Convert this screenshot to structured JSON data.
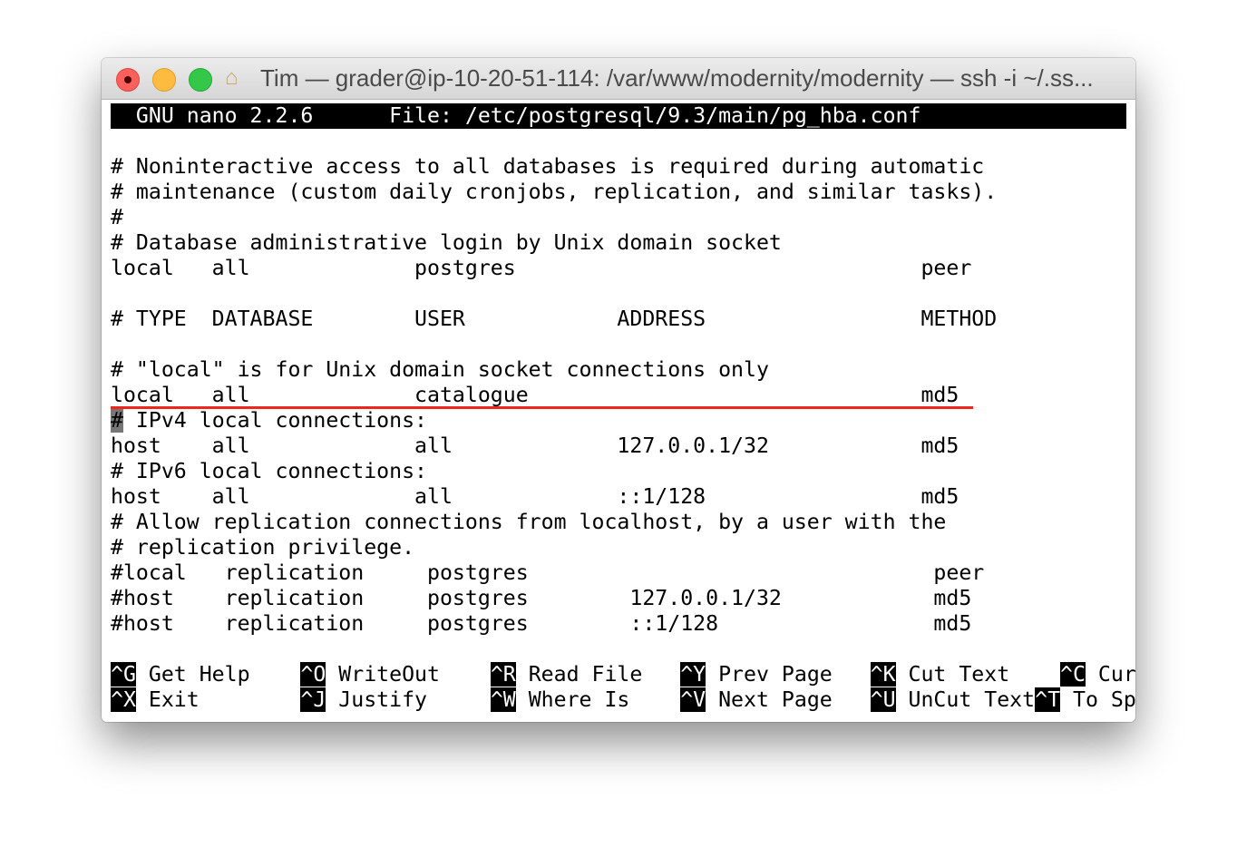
{
  "window": {
    "title": "Tim — grader@ip-10-20-51-114: /var/www/modernity/modernity — ssh -i ~/.ss..."
  },
  "nano": {
    "header": "  GNU nano 2.2.6      File: /etc/postgresql/9.3/main/pg_hba.conf",
    "lines": [
      "",
      "# Noninteractive access to all databases is required during automatic",
      "# maintenance (custom daily cronjobs, replication, and similar tasks).",
      "#",
      "# Database administrative login by Unix domain socket",
      "local   all             postgres                                peer",
      "",
      "# TYPE  DATABASE        USER            ADDRESS                 METHOD",
      "",
      "# \"local\" is for Unix domain socket connections only",
      "local   all             catalogue                               md5",
      "",
      "host    all             all             127.0.0.1/32            md5",
      "# IPv6 local connections:",
      "host    all             all             ::1/128                 md5",
      "# Allow replication connections from localhost, by a user with the",
      "# replication privilege.",
      "#local   replication     postgres                                peer",
      "#host    replication     postgres        127.0.0.1/32            md5",
      "#host    replication     postgres        ::1/128                 md5",
      ""
    ],
    "cursor_line": {
      "cursor_char": "#",
      "rest": " IPv4 local connections:"
    },
    "shortcuts_row1": [
      {
        "key": "^G",
        "label": " Get Help    "
      },
      {
        "key": "^O",
        "label": " WriteOut    "
      },
      {
        "key": "^R",
        "label": " Read File   "
      },
      {
        "key": "^Y",
        "label": " Prev Page   "
      },
      {
        "key": "^K",
        "label": " Cut Text    "
      },
      {
        "key": "^C",
        "label": " Cur Pos"
      }
    ],
    "shortcuts_row2": [
      {
        "key": "^X",
        "label": " Exit        "
      },
      {
        "key": "^J",
        "label": " Justify     "
      },
      {
        "key": "^W",
        "label": " Where Is    "
      },
      {
        "key": "^V",
        "label": " Next Page   "
      },
      {
        "key": "^U",
        "label": " UnCut Text"
      },
      {
        "key": "^T",
        "label": " To Spell"
      }
    ]
  },
  "annotation_color": "#f0261b"
}
